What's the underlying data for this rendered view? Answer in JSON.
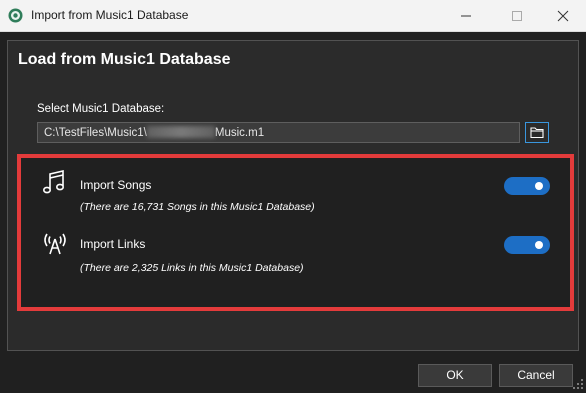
{
  "window": {
    "title": "Import from Music1 Database",
    "icon": "music1-app-icon"
  },
  "header": {
    "title": "Load from Music1 Database"
  },
  "database": {
    "label": "Select Music1 Database:",
    "path_prefix": "C:\\TestFiles\\Music1\\",
    "path_suffix": "Music.m1",
    "browse_icon": "folder-icon"
  },
  "options": [
    {
      "label": "Import Songs",
      "description": "(There are 16,731 Songs in this Music1 Database)",
      "icon": "music-note-icon",
      "enabled": true
    },
    {
      "label": "Import Links",
      "description": "(There are 2,325 Links in this Music1 Database)",
      "icon": "antenna-icon",
      "enabled": true
    }
  ],
  "buttons": {
    "ok": "OK",
    "cancel": "Cancel"
  },
  "colors": {
    "highlight_border": "#e33b3b",
    "toggle_on": "#1d6ec5",
    "accent": "#3a96dd"
  }
}
